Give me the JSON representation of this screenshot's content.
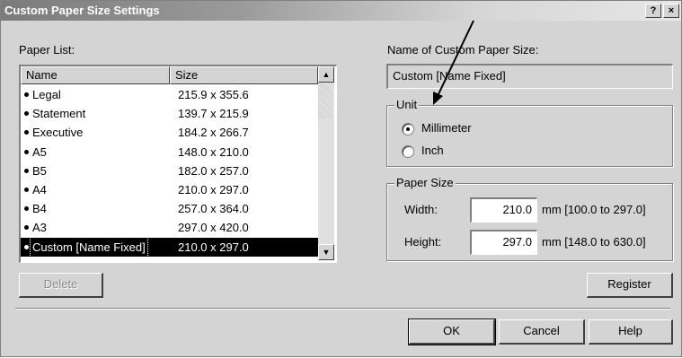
{
  "window": {
    "title": "Custom Paper Size Settings",
    "help_button": "?",
    "close_button": "×"
  },
  "paper_list": {
    "label": "Paper List:",
    "columns": [
      "Name",
      "Size"
    ],
    "rows": [
      {
        "name": "Legal",
        "size": "215.9 x 355.6"
      },
      {
        "name": "Statement",
        "size": "139.7 x 215.9"
      },
      {
        "name": "Executive",
        "size": "184.2 x 266.7"
      },
      {
        "name": "A5",
        "size": "148.0 x 210.0"
      },
      {
        "name": "B5",
        "size": "182.0 x 257.0"
      },
      {
        "name": "A4",
        "size": "210.0 x 297.0"
      },
      {
        "name": "B4",
        "size": "257.0 x 364.0"
      },
      {
        "name": "A3",
        "size": "297.0 x 420.0"
      },
      {
        "name": "Custom [Name Fixed]",
        "size": "210.0 x 297.0"
      }
    ],
    "selected": "Custom [Name Fixed]",
    "scroll_up_icon": "▲",
    "scroll_down_icon": "▼"
  },
  "name_field": {
    "label": "Name of Custom Paper Size:",
    "value": "Custom [Name Fixed]"
  },
  "unit": {
    "title": "Unit",
    "options": [
      "Millimeter",
      "Inch"
    ],
    "selected": "Millimeter"
  },
  "paper_size": {
    "title": "Paper Size",
    "width_label": "Width:",
    "width_value": "210.0",
    "width_range": "mm [100.0 to 297.0]",
    "height_label": "Height:",
    "height_value": "297.0",
    "height_range": "mm [148.0 to 630.0]"
  },
  "buttons": {
    "delete": "Delete",
    "register": "Register",
    "ok": "OK",
    "cancel": "Cancel",
    "help": "Help"
  }
}
